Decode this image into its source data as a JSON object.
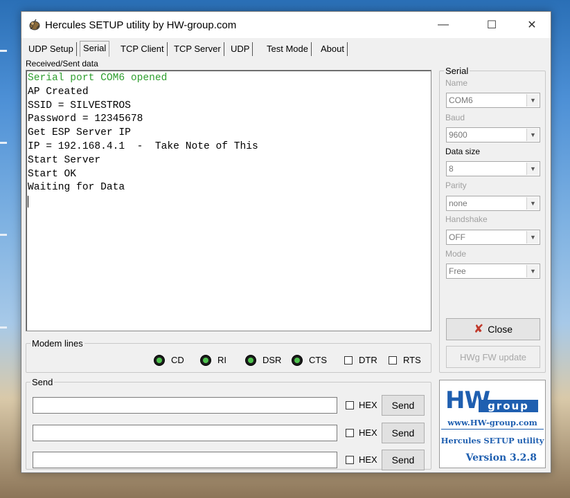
{
  "window": {
    "title": "Hercules SETUP utility by HW-group.com",
    "controls": {
      "minimize": "—",
      "maximize": "☐",
      "close": "✕"
    }
  },
  "tabs": [
    {
      "label": "UDP Setup",
      "active": false
    },
    {
      "label": "Serial",
      "active": true
    },
    {
      "label": "TCP Client",
      "active": false
    },
    {
      "label": "TCP Server",
      "active": false
    },
    {
      "label": "UDP",
      "active": false
    },
    {
      "label": "Test Mode",
      "active": false
    },
    {
      "label": "About",
      "active": false
    }
  ],
  "received": {
    "label": "Received/Sent data",
    "lines": [
      "Serial port COM6 opened",
      "AP Created",
      "SSID = SILVESTROS",
      "Password = 12345678",
      "Get ESP Server IP",
      "IP = 192.168.4.1  -  Take Note of This",
      "Start Server",
      "Start OK",
      "Waiting for Data"
    ]
  },
  "modem": {
    "legend": "Modem lines",
    "leds": [
      "CD",
      "RI",
      "DSR",
      "CTS"
    ],
    "checks": [
      "DTR",
      "RTS"
    ]
  },
  "send": {
    "legend": "Send",
    "rows": [
      {
        "value": "",
        "hex": "HEX",
        "button": "Send"
      },
      {
        "value": "",
        "hex": "HEX",
        "button": "Send"
      },
      {
        "value": "",
        "hex": "HEX",
        "button": "Send"
      }
    ]
  },
  "serial": {
    "legend": "Serial",
    "name_label": "Name",
    "name_value": "COM6",
    "baud_label": "Baud",
    "baud_value": "9600",
    "datasize_label": "Data size",
    "datasize_value": "8",
    "parity_label": "Parity",
    "parity_value": "none",
    "handshake_label": "Handshake",
    "handshake_value": "OFF",
    "mode_label": "Mode",
    "mode_value": "Free",
    "close_button": "Close",
    "fw_button": "HWg FW update"
  },
  "logo": {
    "hw": "HW",
    "group": "group",
    "url": "www.HW-group.com",
    "product": "Hercules SETUP utility",
    "version": "Version  3.2.8"
  },
  "colors": {
    "terminal_status": "#2e9e2e",
    "led_on": "#4ec24e",
    "brand_blue": "#1f5fb0",
    "close_x": "#c0392b"
  }
}
